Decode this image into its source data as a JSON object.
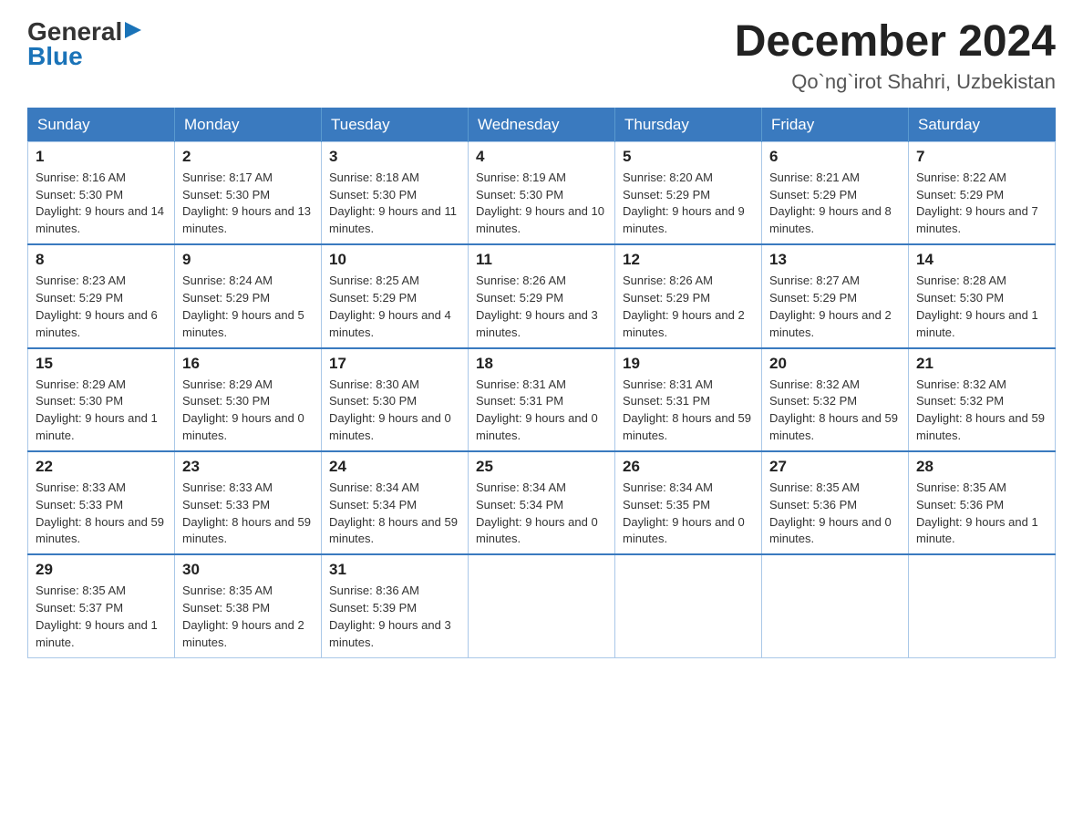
{
  "header": {
    "logo_general": "General",
    "logo_blue": "Blue",
    "month_title": "December 2024",
    "location": "Qo`ng`irot Shahri, Uzbekistan"
  },
  "weekdays": [
    "Sunday",
    "Monday",
    "Tuesday",
    "Wednesday",
    "Thursday",
    "Friday",
    "Saturday"
  ],
  "weeks": [
    [
      {
        "day": "1",
        "sunrise": "8:16 AM",
        "sunset": "5:30 PM",
        "daylight": "9 hours and 14 minutes."
      },
      {
        "day": "2",
        "sunrise": "8:17 AM",
        "sunset": "5:30 PM",
        "daylight": "9 hours and 13 minutes."
      },
      {
        "day": "3",
        "sunrise": "8:18 AM",
        "sunset": "5:30 PM",
        "daylight": "9 hours and 11 minutes."
      },
      {
        "day": "4",
        "sunrise": "8:19 AM",
        "sunset": "5:30 PM",
        "daylight": "9 hours and 10 minutes."
      },
      {
        "day": "5",
        "sunrise": "8:20 AM",
        "sunset": "5:29 PM",
        "daylight": "9 hours and 9 minutes."
      },
      {
        "day": "6",
        "sunrise": "8:21 AM",
        "sunset": "5:29 PM",
        "daylight": "9 hours and 8 minutes."
      },
      {
        "day": "7",
        "sunrise": "8:22 AM",
        "sunset": "5:29 PM",
        "daylight": "9 hours and 7 minutes."
      }
    ],
    [
      {
        "day": "8",
        "sunrise": "8:23 AM",
        "sunset": "5:29 PM",
        "daylight": "9 hours and 6 minutes."
      },
      {
        "day": "9",
        "sunrise": "8:24 AM",
        "sunset": "5:29 PM",
        "daylight": "9 hours and 5 minutes."
      },
      {
        "day": "10",
        "sunrise": "8:25 AM",
        "sunset": "5:29 PM",
        "daylight": "9 hours and 4 minutes."
      },
      {
        "day": "11",
        "sunrise": "8:26 AM",
        "sunset": "5:29 PM",
        "daylight": "9 hours and 3 minutes."
      },
      {
        "day": "12",
        "sunrise": "8:26 AM",
        "sunset": "5:29 PM",
        "daylight": "9 hours and 2 minutes."
      },
      {
        "day": "13",
        "sunrise": "8:27 AM",
        "sunset": "5:29 PM",
        "daylight": "9 hours and 2 minutes."
      },
      {
        "day": "14",
        "sunrise": "8:28 AM",
        "sunset": "5:30 PM",
        "daylight": "9 hours and 1 minute."
      }
    ],
    [
      {
        "day": "15",
        "sunrise": "8:29 AM",
        "sunset": "5:30 PM",
        "daylight": "9 hours and 1 minute."
      },
      {
        "day": "16",
        "sunrise": "8:29 AM",
        "sunset": "5:30 PM",
        "daylight": "9 hours and 0 minutes."
      },
      {
        "day": "17",
        "sunrise": "8:30 AM",
        "sunset": "5:30 PM",
        "daylight": "9 hours and 0 minutes."
      },
      {
        "day": "18",
        "sunrise": "8:31 AM",
        "sunset": "5:31 PM",
        "daylight": "9 hours and 0 minutes."
      },
      {
        "day": "19",
        "sunrise": "8:31 AM",
        "sunset": "5:31 PM",
        "daylight": "8 hours and 59 minutes."
      },
      {
        "day": "20",
        "sunrise": "8:32 AM",
        "sunset": "5:32 PM",
        "daylight": "8 hours and 59 minutes."
      },
      {
        "day": "21",
        "sunrise": "8:32 AM",
        "sunset": "5:32 PM",
        "daylight": "8 hours and 59 minutes."
      }
    ],
    [
      {
        "day": "22",
        "sunrise": "8:33 AM",
        "sunset": "5:33 PM",
        "daylight": "8 hours and 59 minutes."
      },
      {
        "day": "23",
        "sunrise": "8:33 AM",
        "sunset": "5:33 PM",
        "daylight": "8 hours and 59 minutes."
      },
      {
        "day": "24",
        "sunrise": "8:34 AM",
        "sunset": "5:34 PM",
        "daylight": "8 hours and 59 minutes."
      },
      {
        "day": "25",
        "sunrise": "8:34 AM",
        "sunset": "5:34 PM",
        "daylight": "9 hours and 0 minutes."
      },
      {
        "day": "26",
        "sunrise": "8:34 AM",
        "sunset": "5:35 PM",
        "daylight": "9 hours and 0 minutes."
      },
      {
        "day": "27",
        "sunrise": "8:35 AM",
        "sunset": "5:36 PM",
        "daylight": "9 hours and 0 minutes."
      },
      {
        "day": "28",
        "sunrise": "8:35 AM",
        "sunset": "5:36 PM",
        "daylight": "9 hours and 1 minute."
      }
    ],
    [
      {
        "day": "29",
        "sunrise": "8:35 AM",
        "sunset": "5:37 PM",
        "daylight": "9 hours and 1 minute."
      },
      {
        "day": "30",
        "sunrise": "8:35 AM",
        "sunset": "5:38 PM",
        "daylight": "9 hours and 2 minutes."
      },
      {
        "day": "31",
        "sunrise": "8:36 AM",
        "sunset": "5:39 PM",
        "daylight": "9 hours and 3 minutes."
      },
      null,
      null,
      null,
      null
    ]
  ]
}
